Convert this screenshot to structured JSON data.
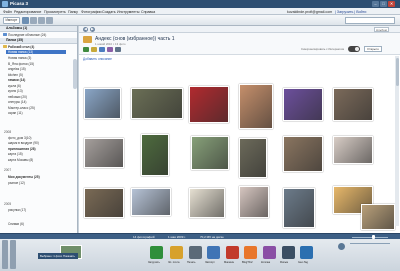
{
  "window": {
    "title": "Picasa 3",
    "minimize": "–",
    "maximize": "□",
    "close": "✕"
  },
  "menu": {
    "items": [
      "Файл",
      "Редактирование",
      "Просмотреть",
      "Папку",
      "Фотографии",
      "Создать",
      "Инструменты",
      "Справка"
    ],
    "account": "kuvaldinde.profi@gmail.com",
    "links": "| Загрузить | Войти"
  },
  "toolbar": {
    "import": "Импорт"
  },
  "sidebar": {
    "sections": {
      "albums": "Альбомы (1)",
      "folders": "Папки (35)"
    },
    "albums": [
      {
        "label": "Последние облачные (24)",
        "selected": false
      }
    ],
    "desktop": "Рабочий стол (4)",
    "selected_album": "Новая папка (13)",
    "folders": [
      "Новая папка (3)",
      "В_Яна фотки (15)",
      "angelas (15)",
      "kitchen (5)",
      "гамаки (14)",
      "кукла (6)",
      "кухня (13)",
      "пейзажи (20)",
      "снегуры (14)",
      "Мастер-класс (25)",
      "скрап (11)"
    ],
    "year_2008": "2008",
    "folders_2008": [
      "фото_дом 3(10)",
      "шарик в воздухе (90)",
      "приглашения (28)",
      "карта (15)",
      "карта Москвы (8)"
    ],
    "year_2007": "2007",
    "folders_2007": [
      "Мои документы (25)",
      "разное (12)"
    ],
    "year_2005": "2005",
    "folders_2005": [
      "рисунки (17)"
    ],
    "other": [
      "Снимки (6)"
    ]
  },
  "main": {
    "nav": {
      "back": "◀",
      "forward": "▶",
      "view_select": "Альбом"
    },
    "album": {
      "title": "Андекс (снов (избранное)) часть 1",
      "subtitle": "1 новий 2010 г. 13 фото",
      "add_description": "Добавить описание",
      "share_label": "Синхронизировать с Интернетом",
      "share_button": "Открыто"
    },
    "photos": [
      {
        "name": "photo-girl-in-field",
        "color": "#8aa6c7"
      },
      {
        "name": "photo-red-flower",
        "color": "#6b6f56"
      },
      {
        "name": "photo-rose",
        "color": "#b12a2f"
      },
      {
        "name": "photo-child-portrait",
        "color": "#c58f6b"
      },
      {
        "name": "photo-purple-flowers",
        "color": "#6c4f9c"
      },
      {
        "name": "photo-dark-plant",
        "color": "#7b6a5a"
      },
      {
        "name": "photo-couple-winter",
        "color": "#a59f9c"
      },
      {
        "name": "photo-wedding-outdoor",
        "color": "#4e6b3e"
      },
      {
        "name": "photo-bride-groom",
        "color": "#87a079"
      },
      {
        "name": "photo-statue",
        "color": "#6c6a5a"
      },
      {
        "name": "photo-cat",
        "color": "#8a7560"
      },
      {
        "name": "photo-couple-studio",
        "color": "#d8cdc6"
      },
      {
        "name": "photo-hands-book",
        "color": "#7a6a55"
      },
      {
        "name": "photo-child-dress",
        "color": "#b6c3d6"
      },
      {
        "name": "photo-jewelry",
        "color": "#e6e0d2"
      },
      {
        "name": "photo-bride-portrait",
        "color": "#d6c6c0"
      },
      {
        "name": "photo-woman-standing",
        "color": "#6c7b8a"
      },
      {
        "name": "photo-sunset",
        "color": "#e8b86a"
      },
      {
        "name": "photo-horse",
        "color": "#b9a07a"
      }
    ]
  },
  "status": {
    "count": "14 фотографий",
    "date": "1 мая 2009 г.",
    "size": "70,2 Мб на диске"
  },
  "tray": {
    "show_selected": "Выбрано: 1 фото   Показать",
    "actions": [
      {
        "label": "Загрузить",
        "color": "#2f8f3a"
      },
      {
        "label": "Эл. почта",
        "color": "#d7a12c"
      },
      {
        "label": "Печать",
        "color": "#5b6a78"
      },
      {
        "label": "Экспорт",
        "color": "#3f74b5"
      },
      {
        "label": "Магазин",
        "color": "#c23a2b"
      },
      {
        "label": "BlogThis!",
        "color": "#e8762b"
      },
      {
        "label": "Коллаж",
        "color": "#8a4fa5"
      },
      {
        "label": "Фильм",
        "color": "#3b4e63"
      },
      {
        "label": "Geo-Tag",
        "color": "#2b6fb0"
      }
    ]
  }
}
